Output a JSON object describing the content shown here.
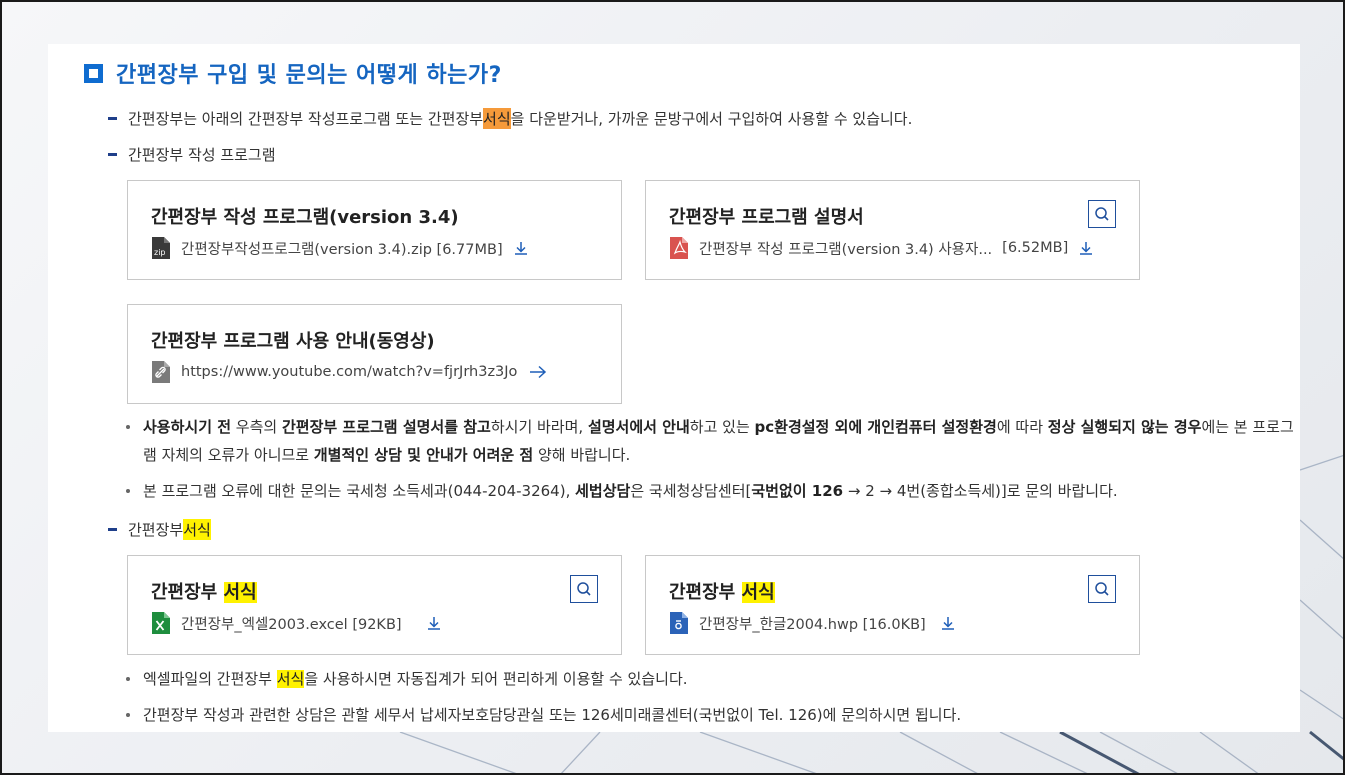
{
  "heading": "간편장부 구입 및 문의는 어떻게 하는가?",
  "intro": {
    "before": "간편장부는 아래의 간편장부 작성프로그램 또는 간편장부 ",
    "highlight": "서식",
    "after": "을 다운받거나, 가까운 문방구에서 구입하여 사용할 수 있습니다."
  },
  "program_section": {
    "label": "간편장부 작성 프로그램"
  },
  "cards_program": [
    {
      "title": "간편장부 작성 프로그램(version 3.4)",
      "file": "간편장부작성프로그램(version 3.4).zip [6.77MB]",
      "icon": "zip-file-icon"
    },
    {
      "title": "간편장부 프로그램 설명서",
      "file": "간편장부 작성 프로그램(version 3.4) 사용자...",
      "size": "[6.52MB]",
      "icon": "pdf-file-icon"
    },
    {
      "title": "간편장부 프로그램 사용 안내(동영상)",
      "link": "https://www.youtube.com/watch?v=fjrJrh3z3Jo",
      "icon": "link-icon"
    }
  ],
  "notes_program": [
    {
      "parts": [
        {
          "t": "사용하시기 전",
          "b": true
        },
        {
          "t": " 우측의 "
        },
        {
          "t": "간편장부 프로그램 설명서를 참고",
          "b": true
        },
        {
          "t": "하시기 바라며, "
        },
        {
          "t": "설명서에서 안내",
          "b": true
        },
        {
          "t": "하고 있는 "
        },
        {
          "t": "pc환경설정 외에 개인컴퓨터 설정환경",
          "b": true
        },
        {
          "t": "에 따라 "
        },
        {
          "t": "정상 실행되지 않는 경우",
          "b": true
        },
        {
          "t": "에는 본 프로그램 자체의 오류가 아니므로 "
        },
        {
          "t": "개별적인 상담 및 안내가 어려운 점",
          "b": true
        },
        {
          "t": " 양해 바랍니다."
        }
      ]
    },
    {
      "parts": [
        {
          "t": "본 프로그램 오류에 대한 문의는 국세청 소득세과(044-204-3264), "
        },
        {
          "t": "세법상담",
          "b": true
        },
        {
          "t": "은 국세청상담센터["
        },
        {
          "t": "국번없이 126",
          "b": true
        },
        {
          "t": " → 2 → 4번(종합소득세)]로 문의 바랍니다."
        }
      ]
    }
  ],
  "form_section": {
    "label_before": "간편장부 ",
    "highlight": "서식"
  },
  "cards_form": [
    {
      "title_before": "간편장부 ",
      "title_highlight": "서식",
      "file": "간편장부_엑셀2003.excel [92KB]",
      "icon": "excel-file-icon"
    },
    {
      "title_before": "간편장부 ",
      "title_highlight": "서식",
      "file": "간편장부_한글2004.hwp [16.0KB]",
      "icon": "hwp-file-icon"
    }
  ],
  "notes_form": [
    {
      "before": "엑셀파일의 간편장부 ",
      "highlight": "서식",
      "after": "을 사용하시면 자동집계가 되어 편리하게 이용할 수 있습니다."
    },
    {
      "text": "간편장부 작성과 관련한 상담은 관할 세무서 납세자보호담당관실 또는 126세미래콜센터(국번없이 Tel. 126)에 문의하시면 됩니다."
    }
  ],
  "colors": {
    "accent": "#1565c0",
    "highlight_orange": "#f59a3a",
    "highlight_yellow": "#fff200"
  }
}
